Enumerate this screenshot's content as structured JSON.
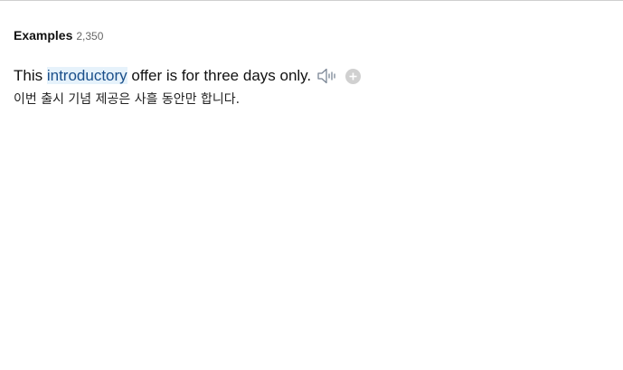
{
  "examples": {
    "title": "Examples",
    "count": "2,350"
  },
  "example_1": {
    "before": "This ",
    "highlight": "introductory",
    "after": " offer is for three days only.",
    "translation": "이번 출시 기념 제공은 사흘 동안만 합니다.",
    "speaker_icon": "speaker-icon",
    "add_icon": "plus-circle-icon"
  },
  "colors": {
    "highlight_bg": "#e6f2fb",
    "highlight_text": "#1a4f8a",
    "add_button": "#d0d0d0"
  }
}
